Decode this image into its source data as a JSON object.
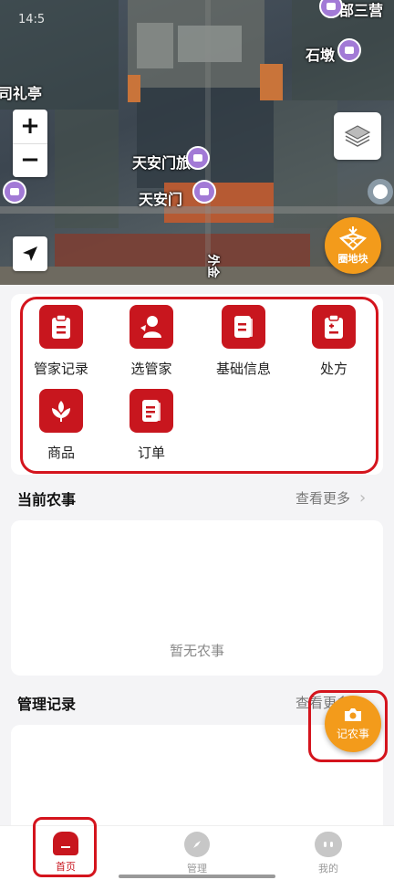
{
  "map": {
    "status_time": "14:5",
    "labels": {
      "top_right": "部三营",
      "shidun": "石墩",
      "left_edge": "司礼亭",
      "tiananmen_tour": "天安门旅",
      "tiananmen": "天安门",
      "bottom_road": "外金"
    },
    "zoom_in": "+",
    "zoom_out": "−",
    "parcel_button": "圈地块"
  },
  "menu": {
    "items": [
      {
        "label": "管家记录",
        "icon": "clipboard-icon"
      },
      {
        "label": "选管家",
        "icon": "person-icon"
      },
      {
        "label": "基础信息",
        "icon": "document-icon"
      },
      {
        "label": "处方",
        "icon": "prescription-icon"
      },
      {
        "label": "商品",
        "icon": "wheat-icon"
      },
      {
        "label": "订单",
        "icon": "order-icon"
      }
    ]
  },
  "current_farm": {
    "title": "当前农事",
    "more": "查看更多",
    "empty": "暂无农事"
  },
  "management": {
    "title": "管理记录",
    "more": "查看更多"
  },
  "record_button": {
    "label": "记农事"
  },
  "tabs": [
    {
      "label": "首页",
      "active": true
    },
    {
      "label": "管理",
      "active": false
    },
    {
      "label": "我的",
      "active": false
    }
  ],
  "colors": {
    "brand_red": "#c8161e",
    "accent_orange": "#f39b1b"
  }
}
